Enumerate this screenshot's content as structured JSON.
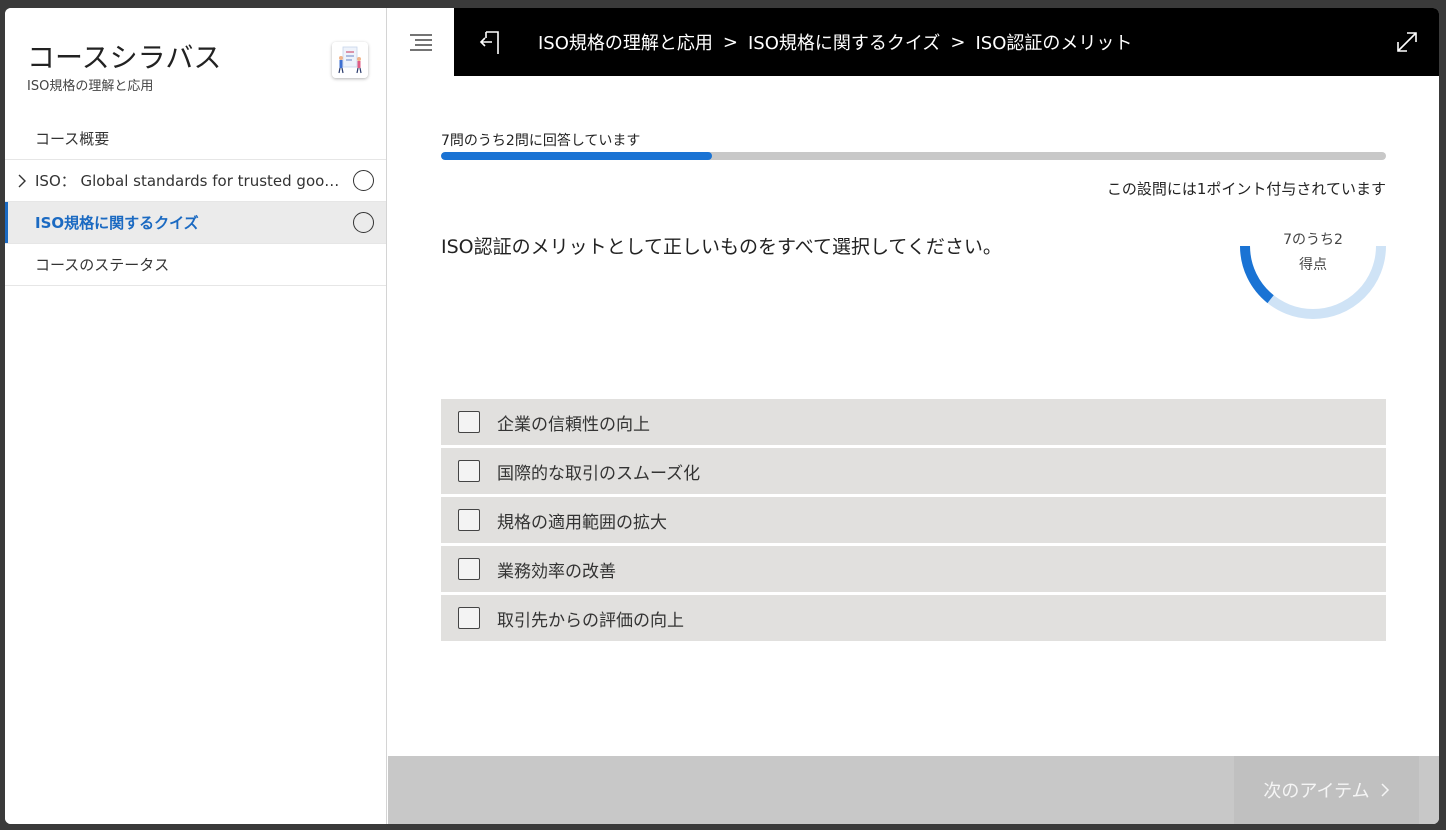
{
  "sidebar": {
    "title": "コースシラバス",
    "subtitle": "ISO規格の理解と応用",
    "items": [
      {
        "label": "コース概要"
      },
      {
        "label": "ISO： Global standards for trusted goods and services"
      },
      {
        "label": "ISO規格に関するクイズ"
      },
      {
        "label": "コースのステータス"
      }
    ]
  },
  "header": {
    "breadcrumbs": [
      "ISO規格の理解と応用",
      "ISO規格に関するクイズ",
      "ISO認証のメリット"
    ],
    "separator": ">"
  },
  "quiz": {
    "progress_text": "7問のうち2問に回答しています",
    "progress_fraction": 0.287,
    "points_note": "この設問には1ポイント付与されています",
    "question": "ISO認証のメリットとして正しいものをすべて選択してください。",
    "score": {
      "top": "7のうち2",
      "label": "得点",
      "fraction": 0.2857
    },
    "options": [
      "企業の信頼性の向上",
      "国際的な取引のスムーズ化",
      "規格の適用範囲の拡大",
      "業務効率の改善",
      "取引先からの評価の向上"
    ]
  },
  "footer": {
    "next_label": "次のアイテム"
  },
  "colors": {
    "accent": "#1a73d4",
    "active_nav": "#1b6ac2",
    "ring_track": "#cfe3f6"
  }
}
